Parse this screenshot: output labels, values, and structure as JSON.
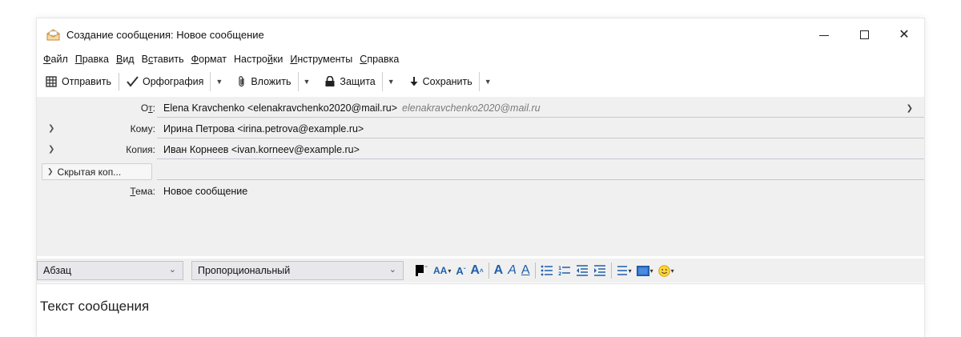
{
  "window": {
    "title": "Создание сообщения: Новое сообщение",
    "controls": {
      "minimize": "—",
      "maximize": "☐",
      "close": "✕"
    }
  },
  "menu": [
    {
      "label": "Файл",
      "accel": "Ф",
      "rest": "айл"
    },
    {
      "label": "Правка",
      "accel": "П",
      "rest": "равка"
    },
    {
      "label": "Вид",
      "accel": "В",
      "rest": "ид"
    },
    {
      "label": "Вставить",
      "pre": "В",
      "accel": "с",
      "rest": "тавить"
    },
    {
      "label": "Формат",
      "accel": "Ф",
      "rest": "ормат"
    },
    {
      "label": "Настройки",
      "pre": "Настро",
      "accel": "й",
      "rest": "ки"
    },
    {
      "label": "Инструменты",
      "accel": "И",
      "rest": "нструменты"
    },
    {
      "label": "Справка",
      "accel": "С",
      "rest": "правка"
    }
  ],
  "toolbar": {
    "send": "Отправить",
    "spelling": "Орфография",
    "attach": "Вложить",
    "security": "Защита",
    "save": "Сохранить",
    "dropdown_glyph": "▼"
  },
  "fields": {
    "from_label_pre": "О",
    "from_label_accel": "т",
    "from_label_post": ":",
    "from_value": "Elena Kravchenko <elenakravchenko2020@mail.ru>",
    "from_identity": "elenakravchenko2020@mail.ru",
    "to_label": "Кому:",
    "to_value": "Ирина Петрова <irina.petrova@example.ru>",
    "cc_label": "Копия:",
    "cc_value": "Иван Корнеев <ivan.korneev@example.ru>",
    "bcc_label": "Скрытая коп...",
    "bcc_value": "",
    "subject_label_accel": "Т",
    "subject_label_rest": "ема:",
    "subject_value": "Новое сообщение"
  },
  "format": {
    "paragraph": "Абзац",
    "font": "Пропорциональный",
    "text_color": "#000000",
    "accent_color": "#1f5faa"
  },
  "body": {
    "text": "Текст сообщения"
  }
}
